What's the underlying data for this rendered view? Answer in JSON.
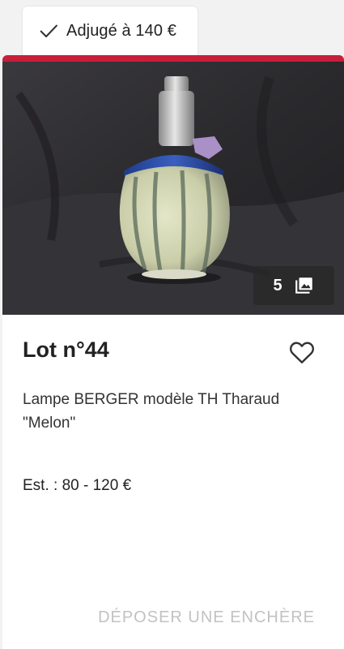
{
  "status_tab": {
    "icon": "check-icon",
    "label": "Adjugé à 140 €"
  },
  "lot": {
    "photo_count": "5",
    "photo_count_icon": "gallery-icon",
    "title": "Lot n°44",
    "favorite_icon": "heart-outline-icon",
    "description": "Lampe BERGER modèle TH Tharaud \"Melon\"",
    "estimate": "Est. : 80 - 120 €",
    "bid_label": "DÉPOSER UNE ENCHÈRE"
  },
  "colors": {
    "accent": "#c81e3a",
    "disabled_text": "#c2c2c2"
  }
}
